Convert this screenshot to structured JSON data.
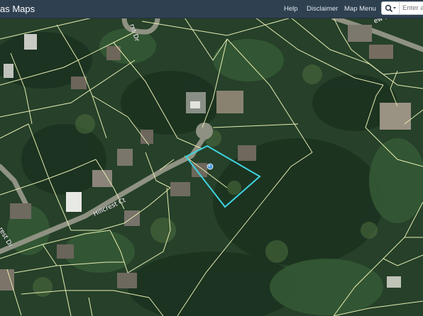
{
  "header": {
    "title": "as Maps",
    "nav": [
      {
        "label": "Help"
      },
      {
        "label": "Disclaimer"
      },
      {
        "label": "Map Menu"
      }
    ],
    "search": {
      "icon": "search-icon",
      "placeholder": "Enter a"
    }
  },
  "map": {
    "streets": {
      "top_partial": "rst Dr",
      "top_right_partial": "ew Dr",
      "center": "Hillcrest Ct",
      "left_partial": "rest Dr"
    },
    "selected_parcel_outline_color": "#3fd4e0",
    "parcel_line_color": "#e6ecb0",
    "location_marker": "pin"
  }
}
